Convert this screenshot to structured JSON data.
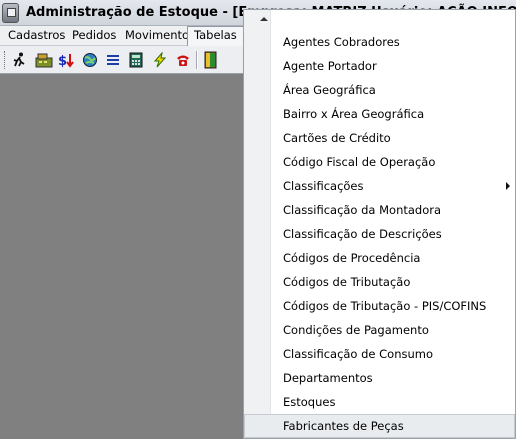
{
  "window": {
    "title": "Administração de Estoque - [Empresa: MATRIZ     Usuário: AÇÃO INFORMÁTICA]"
  },
  "menubar": {
    "items": [
      {
        "label": "Cadastros"
      },
      {
        "label": "Pedidos"
      },
      {
        "label": "Movimento"
      },
      {
        "label": "Tabelas"
      }
    ],
    "active_item": "Tabelas"
  },
  "toolbar": {
    "buttons": [
      {
        "icon": "runner-exit-icon"
      },
      {
        "icon": "cash-register-icon"
      },
      {
        "icon": "price-change-icon"
      },
      {
        "icon": "globe-icon"
      },
      {
        "icon": "list-icon"
      },
      {
        "icon": "calculator-icon"
      },
      {
        "icon": "lightning-icon"
      },
      {
        "icon": "telephone-icon"
      },
      {
        "icon": "door-exit-icon"
      }
    ]
  },
  "dropdown": {
    "items": [
      {
        "label": "Agentes Cobradores"
      },
      {
        "label": "Agente Portador"
      },
      {
        "label": "Área Geográfica"
      },
      {
        "label": "Bairro x Área Geográfica"
      },
      {
        "label": "Cartões de Crédito"
      },
      {
        "label": "Código Fiscal de Operação"
      },
      {
        "label": "Classificações",
        "has_submenu": true
      },
      {
        "label": "Classificação da Montadora"
      },
      {
        "label": "Classificação de Descrições"
      },
      {
        "label": "Códigos de Procedência"
      },
      {
        "label": "Códigos de Tributação"
      },
      {
        "label": "Códigos de Tributação - PIS/COFINS"
      },
      {
        "label": "Condições de Pagamento"
      },
      {
        "label": "Classificação de Consumo"
      },
      {
        "label": "Departamentos"
      },
      {
        "label": "Estoques"
      },
      {
        "label": "Fabricantes de Peças",
        "highlighted": true
      }
    ]
  },
  "colors": {
    "workspace": "#808080",
    "menu_background": "#ffffff",
    "highlight": "#e9ecef"
  }
}
